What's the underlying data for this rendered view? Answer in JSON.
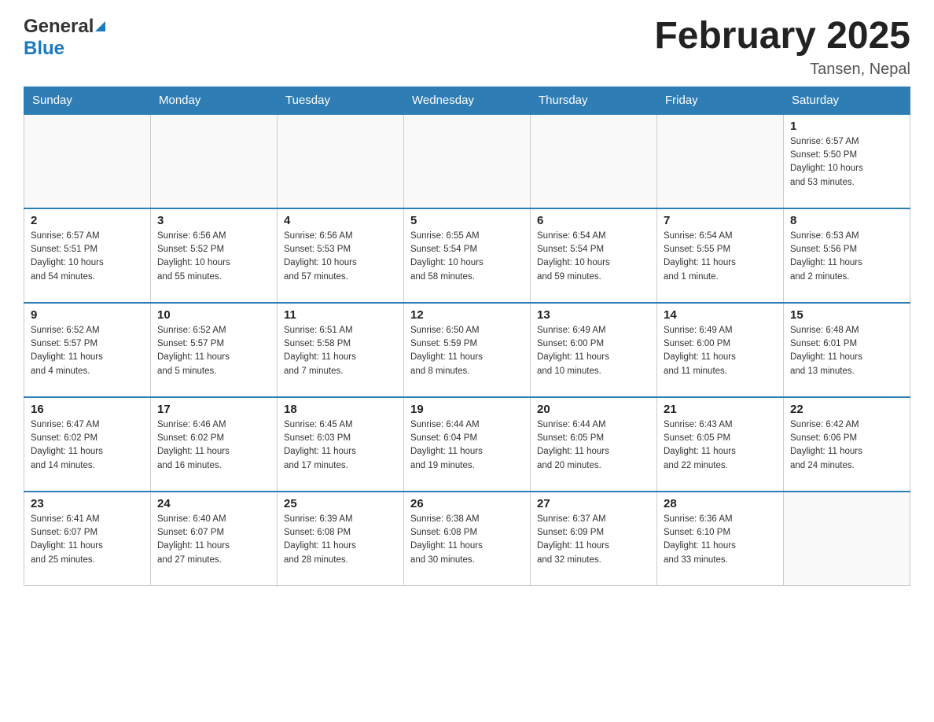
{
  "header": {
    "logo_general": "General",
    "logo_blue": "Blue",
    "title": "February 2025",
    "location": "Tansen, Nepal"
  },
  "calendar": {
    "days_of_week": [
      "Sunday",
      "Monday",
      "Tuesday",
      "Wednesday",
      "Thursday",
      "Friday",
      "Saturday"
    ],
    "weeks": [
      [
        {
          "day": "",
          "info": ""
        },
        {
          "day": "",
          "info": ""
        },
        {
          "day": "",
          "info": ""
        },
        {
          "day": "",
          "info": ""
        },
        {
          "day": "",
          "info": ""
        },
        {
          "day": "",
          "info": ""
        },
        {
          "day": "1",
          "info": "Sunrise: 6:57 AM\nSunset: 5:50 PM\nDaylight: 10 hours\nand 53 minutes."
        }
      ],
      [
        {
          "day": "2",
          "info": "Sunrise: 6:57 AM\nSunset: 5:51 PM\nDaylight: 10 hours\nand 54 minutes."
        },
        {
          "day": "3",
          "info": "Sunrise: 6:56 AM\nSunset: 5:52 PM\nDaylight: 10 hours\nand 55 minutes."
        },
        {
          "day": "4",
          "info": "Sunrise: 6:56 AM\nSunset: 5:53 PM\nDaylight: 10 hours\nand 57 minutes."
        },
        {
          "day": "5",
          "info": "Sunrise: 6:55 AM\nSunset: 5:54 PM\nDaylight: 10 hours\nand 58 minutes."
        },
        {
          "day": "6",
          "info": "Sunrise: 6:54 AM\nSunset: 5:54 PM\nDaylight: 10 hours\nand 59 minutes."
        },
        {
          "day": "7",
          "info": "Sunrise: 6:54 AM\nSunset: 5:55 PM\nDaylight: 11 hours\nand 1 minute."
        },
        {
          "day": "8",
          "info": "Sunrise: 6:53 AM\nSunset: 5:56 PM\nDaylight: 11 hours\nand 2 minutes."
        }
      ],
      [
        {
          "day": "9",
          "info": "Sunrise: 6:52 AM\nSunset: 5:57 PM\nDaylight: 11 hours\nand 4 minutes."
        },
        {
          "day": "10",
          "info": "Sunrise: 6:52 AM\nSunset: 5:57 PM\nDaylight: 11 hours\nand 5 minutes."
        },
        {
          "day": "11",
          "info": "Sunrise: 6:51 AM\nSunset: 5:58 PM\nDaylight: 11 hours\nand 7 minutes."
        },
        {
          "day": "12",
          "info": "Sunrise: 6:50 AM\nSunset: 5:59 PM\nDaylight: 11 hours\nand 8 minutes."
        },
        {
          "day": "13",
          "info": "Sunrise: 6:49 AM\nSunset: 6:00 PM\nDaylight: 11 hours\nand 10 minutes."
        },
        {
          "day": "14",
          "info": "Sunrise: 6:49 AM\nSunset: 6:00 PM\nDaylight: 11 hours\nand 11 minutes."
        },
        {
          "day": "15",
          "info": "Sunrise: 6:48 AM\nSunset: 6:01 PM\nDaylight: 11 hours\nand 13 minutes."
        }
      ],
      [
        {
          "day": "16",
          "info": "Sunrise: 6:47 AM\nSunset: 6:02 PM\nDaylight: 11 hours\nand 14 minutes."
        },
        {
          "day": "17",
          "info": "Sunrise: 6:46 AM\nSunset: 6:02 PM\nDaylight: 11 hours\nand 16 minutes."
        },
        {
          "day": "18",
          "info": "Sunrise: 6:45 AM\nSunset: 6:03 PM\nDaylight: 11 hours\nand 17 minutes."
        },
        {
          "day": "19",
          "info": "Sunrise: 6:44 AM\nSunset: 6:04 PM\nDaylight: 11 hours\nand 19 minutes."
        },
        {
          "day": "20",
          "info": "Sunrise: 6:44 AM\nSunset: 6:05 PM\nDaylight: 11 hours\nand 20 minutes."
        },
        {
          "day": "21",
          "info": "Sunrise: 6:43 AM\nSunset: 6:05 PM\nDaylight: 11 hours\nand 22 minutes."
        },
        {
          "day": "22",
          "info": "Sunrise: 6:42 AM\nSunset: 6:06 PM\nDaylight: 11 hours\nand 24 minutes."
        }
      ],
      [
        {
          "day": "23",
          "info": "Sunrise: 6:41 AM\nSunset: 6:07 PM\nDaylight: 11 hours\nand 25 minutes."
        },
        {
          "day": "24",
          "info": "Sunrise: 6:40 AM\nSunset: 6:07 PM\nDaylight: 11 hours\nand 27 minutes."
        },
        {
          "day": "25",
          "info": "Sunrise: 6:39 AM\nSunset: 6:08 PM\nDaylight: 11 hours\nand 28 minutes."
        },
        {
          "day": "26",
          "info": "Sunrise: 6:38 AM\nSunset: 6:08 PM\nDaylight: 11 hours\nand 30 minutes."
        },
        {
          "day": "27",
          "info": "Sunrise: 6:37 AM\nSunset: 6:09 PM\nDaylight: 11 hours\nand 32 minutes."
        },
        {
          "day": "28",
          "info": "Sunrise: 6:36 AM\nSunset: 6:10 PM\nDaylight: 11 hours\nand 33 minutes."
        },
        {
          "day": "",
          "info": ""
        }
      ]
    ]
  }
}
